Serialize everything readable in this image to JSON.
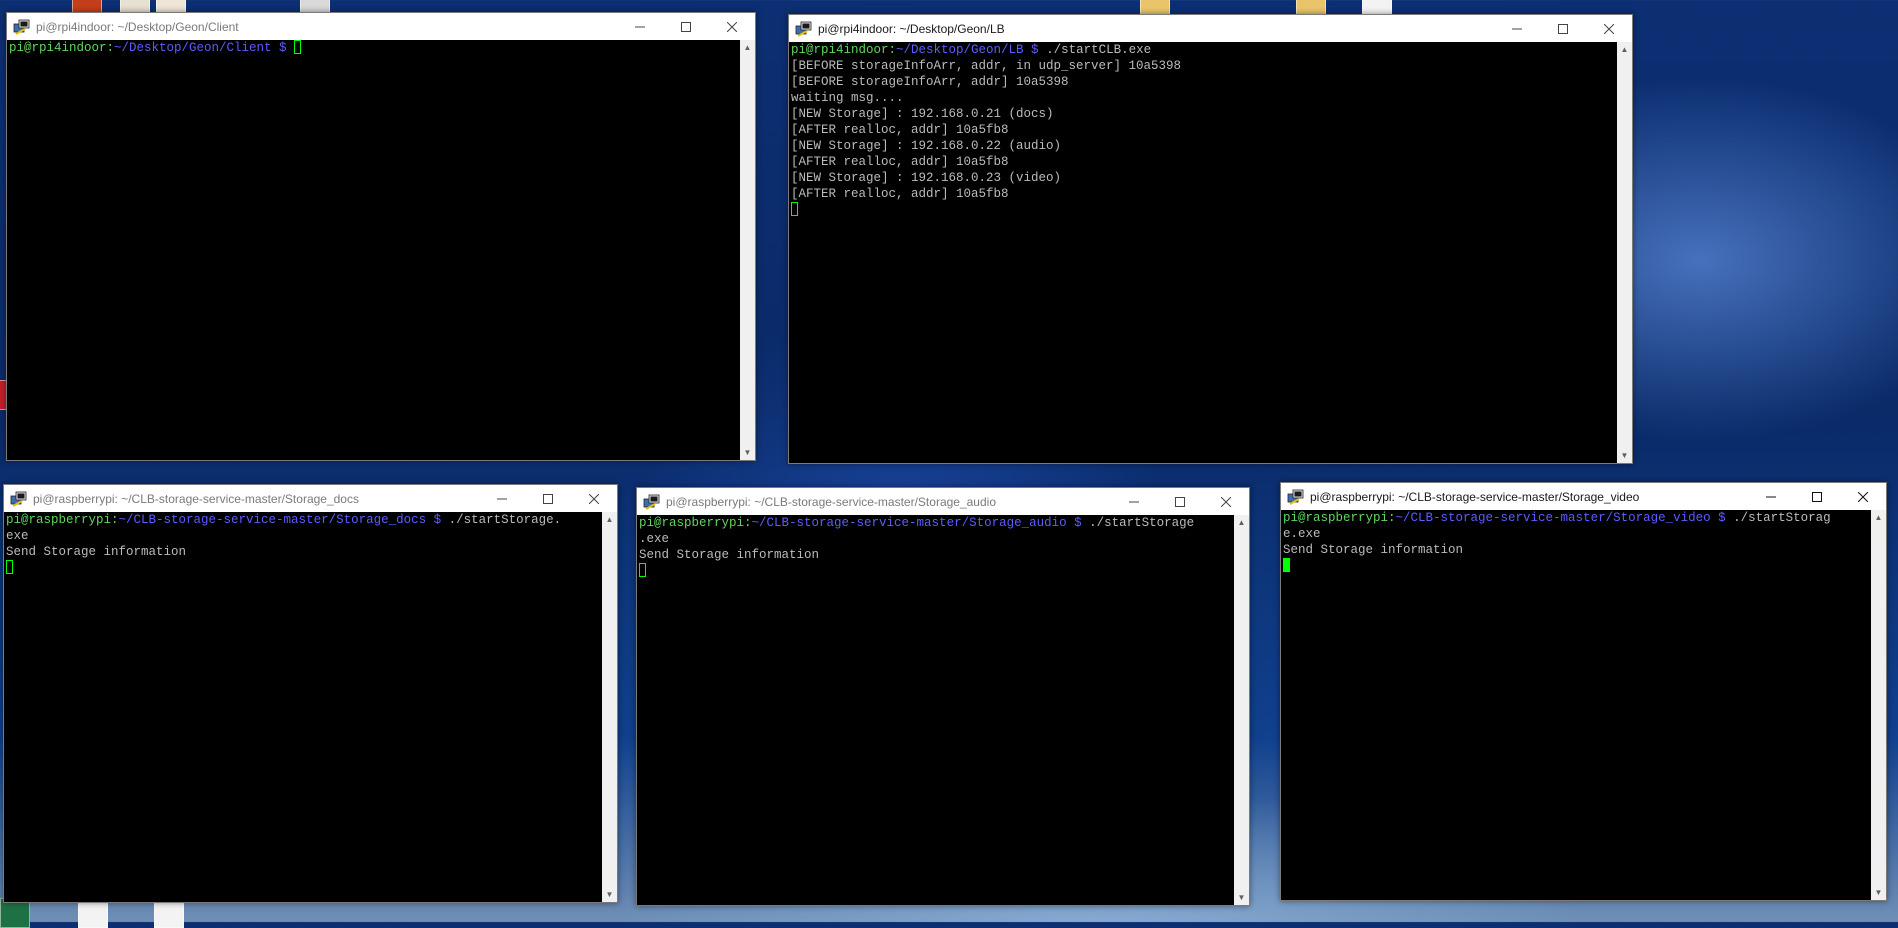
{
  "windows": {
    "client": {
      "title": "pi@rpi4indoor: ~/Desktop/Geon/Client",
      "prompt_user": "pi@rpi4indoor:",
      "prompt_path": "~/Desktop/Geon/Client $"
    },
    "lb": {
      "title": "pi@rpi4indoor: ~/Desktop/Geon/LB",
      "prompt_user": "pi@rpi4indoor:",
      "prompt_path": "~/Desktop/Geon/LB $",
      "command": " ./startCLB.exe",
      "output": [
        "[BEFORE storageInfoArr, addr, in udp_server] 10a5398",
        "[BEFORE storageInfoArr, addr] 10a5398",
        "waiting msg....",
        "[NEW Storage] : 192.168.0.21 (docs)",
        "[AFTER realloc, addr] 10a5fb8",
        "[NEW Storage] : 192.168.0.22 (audio)",
        "[AFTER realloc, addr] 10a5fb8",
        "[NEW Storage] : 192.168.0.23 (video)",
        "[AFTER realloc, addr] 10a5fb8"
      ]
    },
    "docs": {
      "title": "pi@raspberrypi: ~/CLB-storage-service-master/Storage_docs",
      "prompt_user": "pi@raspberrypi:",
      "prompt_path": "~/CLB-storage-service-master/Storage_docs $",
      "command": " ./startStorage.",
      "command_wrap": "exe",
      "output": "Send Storage information"
    },
    "audio": {
      "title": "pi@raspberrypi: ~/CLB-storage-service-master/Storage_audio",
      "prompt_user": "pi@raspberrypi:",
      "prompt_path": "~/CLB-storage-service-master/Storage_audio $",
      "command": " ./startStorage",
      "command_wrap": ".exe",
      "output": "Send Storage information"
    },
    "video": {
      "title": "pi@raspberrypi: ~/CLB-storage-service-master/Storage_video",
      "prompt_user": "pi@raspberrypi:",
      "prompt_path": "~/CLB-storage-service-master/Storage_video $",
      "command": " ./startStorag",
      "command_wrap": "e.exe",
      "output": "Send Storage information"
    }
  },
  "colors": {
    "prompt_user": "#5fd75f",
    "prompt_path": "#5c5cff",
    "terminal_text": "#bbbbbb",
    "cursor": "#00ff00"
  },
  "icons": [
    "putty-icon",
    "minimize-icon",
    "maximize-icon",
    "close-icon",
    "scroll-up-arrow-icon",
    "scroll-down-arrow-icon"
  ]
}
